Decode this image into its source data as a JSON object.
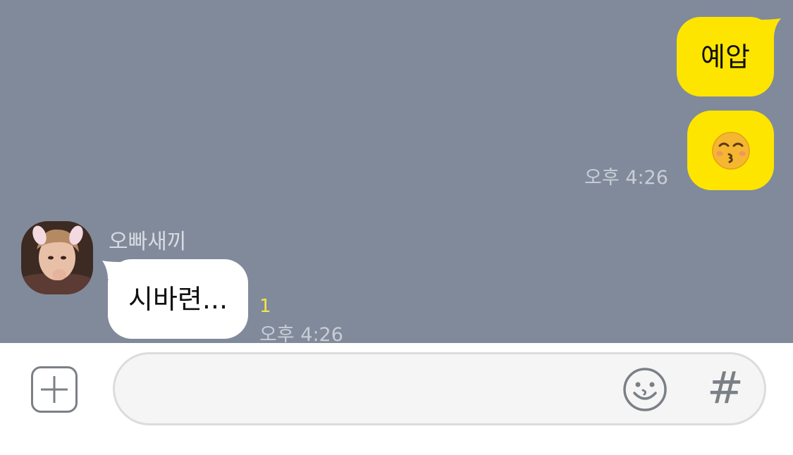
{
  "messages": {
    "mine_1": {
      "text": "예압"
    },
    "mine_2": {
      "emoji": "kissing-face-with-closed-eyes",
      "time": "오후 4:26"
    },
    "theirs_1": {
      "sender": "오빠새끼",
      "text": "시바련...",
      "unread_count": "1",
      "time": "오후 4:26"
    }
  },
  "input": {
    "placeholder": "",
    "value": ""
  },
  "icons": {
    "plus": "plus-square-icon",
    "emoticon": "smiley-icon",
    "hashtag": "hash-icon"
  },
  "colors": {
    "chat_background": "#808a9b",
    "my_bubble": "#fee500",
    "their_bubble": "#ffffff",
    "unread": "#f7e34a"
  }
}
